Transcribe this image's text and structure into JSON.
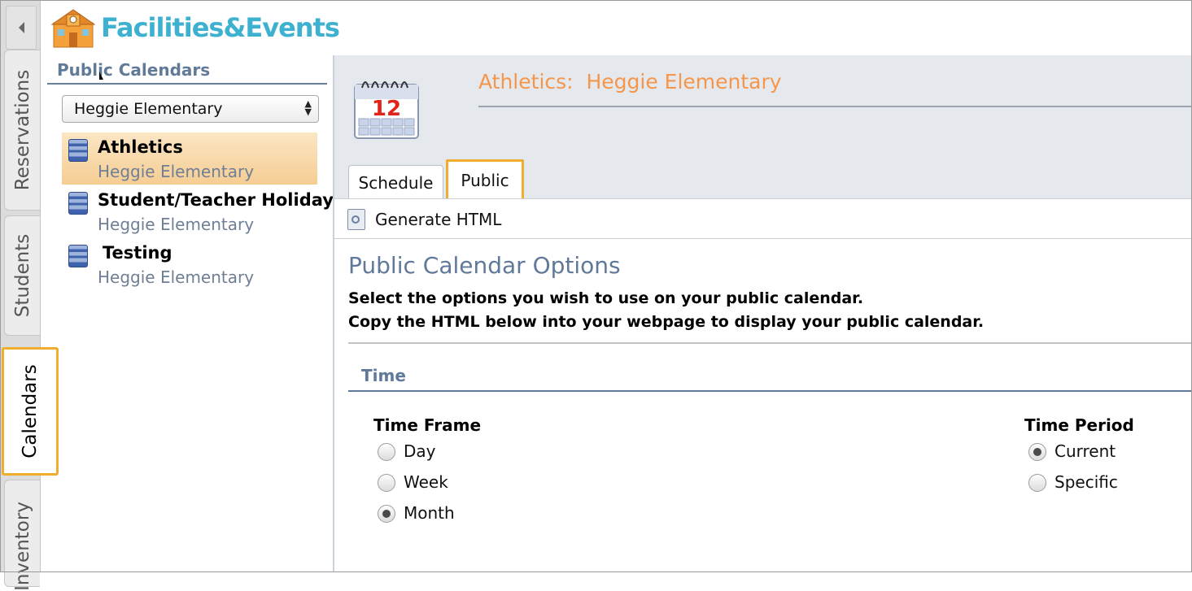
{
  "app": {
    "logo_text": "Facilities&Events"
  },
  "side_tabs": [
    {
      "label": "Reservations",
      "active": false
    },
    {
      "label": "Students",
      "active": false
    },
    {
      "label": "Calendars",
      "active": true
    },
    {
      "label": "Inventory",
      "active": false
    }
  ],
  "left_panel": {
    "heading": "Public Calendars",
    "school_select": {
      "value": "Heggie Elementary"
    },
    "calendars": [
      {
        "name": "Athletics",
        "school": "Heggie Elementary",
        "selected": true
      },
      {
        "name": "Student/Teacher Holiday",
        "school": "Heggie Elementary",
        "selected": false
      },
      {
        "name": "Testing",
        "school": "Heggie Elementary",
        "selected": false
      }
    ]
  },
  "header": {
    "title": "Athletics:  Heggie Elementary",
    "calendar_icon_number": "12",
    "tabs": [
      {
        "label": "Schedule",
        "active": false
      },
      {
        "label": "Public",
        "active": true
      }
    ]
  },
  "toolbar": {
    "generate_label": "Generate HTML"
  },
  "options": {
    "title": "Public Calendar Options",
    "line1": "Select the options you wish to use on your public calendar.",
    "line2": "Copy the HTML below into your webpage to display your public calendar.",
    "section": "Time",
    "time_frame": {
      "label": "Time Frame",
      "choices": [
        "Day",
        "Week",
        "Month"
      ],
      "selected": "Month"
    },
    "time_period": {
      "label": "Time Period",
      "choices": [
        "Current",
        "Specific"
      ],
      "selected": "Current"
    }
  },
  "colors": {
    "accent_orange": "#f0ad2e",
    "title_orange": "#f5964a",
    "heading_blue": "#60799a",
    "logo_blue": "#3eb1d0"
  }
}
